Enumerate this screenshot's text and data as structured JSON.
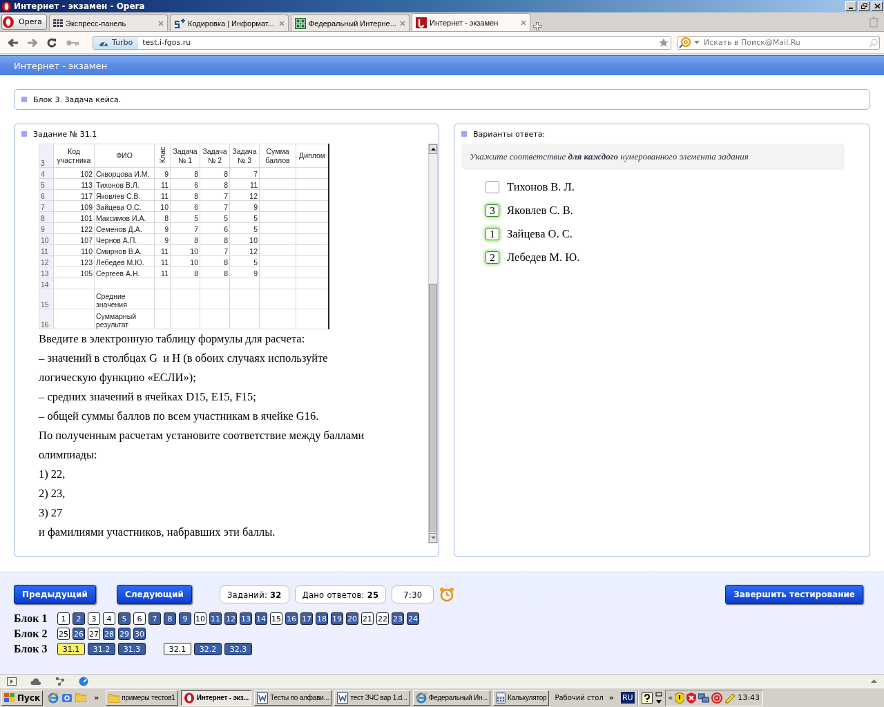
{
  "window": {
    "title": "Интернет - экзамен - Opera"
  },
  "browser": {
    "menu_button": "Opera",
    "tabs": [
      {
        "kind": "grid",
        "label": "Экспресс-панель",
        "selected": false
      },
      {
        "kind": "plus5",
        "label": "Кодировка | Информат...",
        "selected": false
      },
      {
        "kind": "fgos",
        "label": "Федеральный Интерне...",
        "selected": false
      },
      {
        "kind": "exam",
        "label": "Интернет - экзамен",
        "selected": true
      }
    ],
    "turbo": "Turbo",
    "address": "test.i-fgos.ru",
    "search": {
      "placeholder": "Искать в Поиск@Mail.Ru"
    }
  },
  "page": {
    "title": "Интернет - экзамен",
    "block": "Блок 3. Задача кейса.",
    "task": {
      "title": "Задание № 31.1",
      "sheet": {
        "header": {
          "row": "3",
          "code": "Код участника",
          "name": "ФИО",
          "grade": "Клас",
          "task_1": "Задача № 1",
          "task_2": "Задача № 2",
          "task_3": "Задача № 3",
          "sum": "Сумма баллов",
          "diploma": "Диплом"
        },
        "rows": [
          {
            "row": "4",
            "code": "102",
            "name": "Скворцова И.М.",
            "grade": "9",
            "task_1": "8",
            "task_2": "8",
            "task_3": "7"
          },
          {
            "row": "5",
            "code": "113",
            "name": "Тихонов В.Л.",
            "grade": "11",
            "task_1": "6",
            "task_2": "8",
            "task_3": "11"
          },
          {
            "row": "6",
            "code": "117",
            "name": "Яковлев С.В.",
            "grade": "11",
            "task_1": "8",
            "task_2": "7",
            "task_3": "12"
          },
          {
            "row": "7",
            "code": "109",
            "name": "Зайцева О.С.",
            "grade": "10",
            "task_1": "6",
            "task_2": "7",
            "task_3": "9"
          },
          {
            "row": "8",
            "code": "101",
            "name": "Максимов И.А.",
            "grade": "8",
            "task_1": "5",
            "task_2": "5",
            "task_3": "5"
          },
          {
            "row": "9",
            "code": "122",
            "name": "Семенов Д.А.",
            "grade": "9",
            "task_1": "7",
            "task_2": "6",
            "task_3": "5"
          },
          {
            "row": "10",
            "code": "107",
            "name": "Чернов А.П.",
            "grade": "9",
            "task_1": "8",
            "task_2": "8",
            "task_3": "10"
          },
          {
            "row": "11",
            "code": "110",
            "name": "Смирнов В.А.",
            "grade": "11",
            "task_1": "10",
            "task_2": "7",
            "task_3": "12"
          },
          {
            "row": "12",
            "code": "123",
            "name": "Лебедев М.Ю.",
            "grade": "11",
            "task_1": "10",
            "task_2": "8",
            "task_3": "5"
          },
          {
            "row": "13",
            "code": "105",
            "name": "Сергеев А.Н.",
            "grade": "11",
            "task_1": "8",
            "task_2": "8",
            "task_3": "9"
          },
          {
            "row": "14"
          },
          {
            "row": "15",
            "name": "Средние значения"
          },
          {
            "row": "16",
            "name": "Суммарный результат"
          }
        ]
      },
      "paragraphs": [
        "Введите в электронную таблицу формулы для расчета:",
        "– значений в столбцах G  и H (в обоих случаях используйте логическую функцию «ЕСЛИ»);",
        "– средних значений в ячейках D15, E15, F15;",
        "– общей суммы баллов по всем участникам в ячейке G16.",
        "По полученным расчетам установите соответствие между баллами олимпиады:",
        "1) 22,",
        "2) 23,",
        "3) 27",
        "и фамилиями участников, набравших эти баллы."
      ]
    },
    "answers": {
      "title": "Варианты ответа:",
      "instruction": "Укажите соответствие **для каждого** нумерованного элемента задания",
      "items": [
        {
          "label": "Тихонов В. Л."
        },
        {
          "label": "Яковлев С. В.",
          "value": "3"
        },
        {
          "label": "Зайцева О. С.",
          "value": "1"
        },
        {
          "label": "Лебедев М. Ю.",
          "value": "2"
        }
      ]
    },
    "nav": {
      "prev": "Предыдущий",
      "next": "Следующий",
      "tasks": "Заданий: **32**",
      "answered": "Дано ответов: **25**",
      "time": "7:30",
      "finish": "Завершить тестирование",
      "blocks": [
        {
          "label": "Блок 1",
          "items": [
            {
              "n": "1",
              "answered": false,
              "selected": false
            },
            {
              "n": "2",
              "answered": true,
              "selected": false
            },
            {
              "n": "3",
              "answered": false,
              "selected": false
            },
            {
              "n": "4",
              "answered": false,
              "selected": false
            },
            {
              "n": "5",
              "answered": true,
              "selected": false
            },
            {
              "n": "6",
              "answered": false,
              "selected": false
            },
            {
              "n": "7",
              "answered": true,
              "selected": false
            },
            {
              "n": "8",
              "answered": true,
              "selected": false
            },
            {
              "n": "9",
              "answered": true,
              "selected": false
            },
            {
              "n": "10",
              "answered": false,
              "selected": false
            },
            {
              "n": "11",
              "answered": true,
              "selected": false
            },
            {
              "n": "12",
              "answered": true,
              "selected": false
            },
            {
              "n": "13",
              "answered": true,
              "selected": false
            },
            {
              "n": "14",
              "answered": true,
              "selected": false
            },
            {
              "n": "15",
              "answered": false,
              "selected": false
            },
            {
              "n": "16",
              "answered": true,
              "selected": false
            },
            {
              "n": "17",
              "answered": true,
              "selected": false
            },
            {
              "n": "18",
              "answered": true,
              "selected": false
            },
            {
              "n": "19",
              "answered": true,
              "selected": false
            },
            {
              "n": "20",
              "answered": true,
              "selected": false
            },
            {
              "n": "21",
              "answered": false,
              "selected": false
            },
            {
              "n": "22",
              "answered": false,
              "selected": false
            },
            {
              "n": "23",
              "answered": true,
              "selected": false
            },
            {
              "n": "24",
              "answered": true,
              "selected": false
            }
          ]
        },
        {
          "label": "Блок 2",
          "items": [
            {
              "n": "25",
              "answered": false,
              "selected": false
            },
            {
              "n": "26",
              "answered": true,
              "selected": false
            },
            {
              "n": "27",
              "answered": false,
              "selected": false
            },
            {
              "n": "28",
              "answered": true,
              "selected": false
            },
            {
              "n": "29",
              "answered": true,
              "selected": false
            },
            {
              "n": "30",
              "answered": true,
              "selected": false
            }
          ]
        },
        {
          "label": "Блок 3",
          "items": [
            {
              "n": "31.1",
              "answered": false,
              "selected": true
            },
            {
              "n": "31.2",
              "answered": true,
              "selected": false
            },
            {
              "n": "31.3",
              "answered": true,
              "selected": false
            },
            {
              "n": "32.1",
              "answered": false,
              "selected": false
            },
            {
              "n": "32.2",
              "answered": true,
              "selected": false
            },
            {
              "n": "32.3",
              "answered": true,
              "selected": false
            }
          ]
        }
      ]
    }
  },
  "taskbar": {
    "start": "Пуск",
    "more": "»",
    "items": [
      {
        "kind": "folder",
        "label": "примеры тестов1",
        "selected": false
      },
      {
        "kind": "opera",
        "label": "Интернет - экз...",
        "selected": true
      },
      {
        "kind": "word",
        "label": "Тесты по алфави...",
        "selected": false
      },
      {
        "kind": "word",
        "label": "тест ЗЧС вар 1.d...",
        "selected": false
      },
      {
        "kind": "ie",
        "label": "Федеральный Ин...",
        "selected": false
      },
      {
        "kind": "calc",
        "label": "Калькулятор",
        "selected": false
      }
    ],
    "desktop": "Рабочий стол",
    "desktop_more": "»",
    "language": "RU",
    "tray_toggle": "«",
    "clock": "13:43"
  }
}
